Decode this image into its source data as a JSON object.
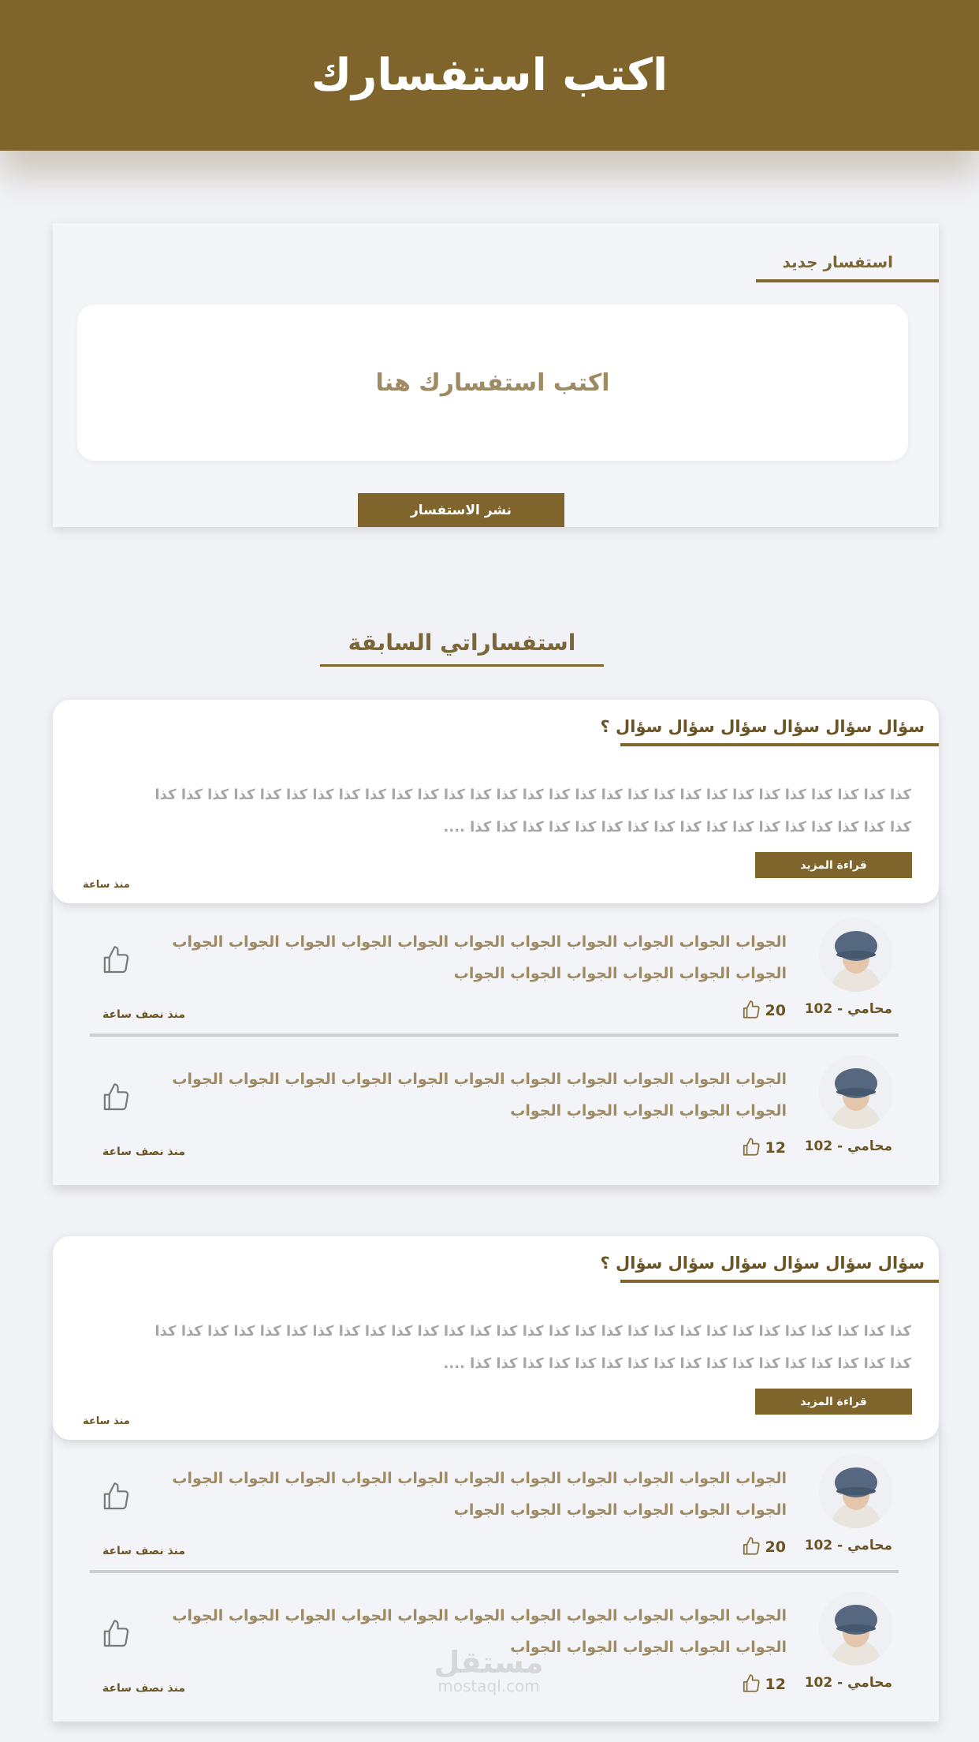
{
  "header": {
    "title": "اكتب استفسارك"
  },
  "new_inquiry": {
    "label": "استفسار جديد",
    "placeholder": "اكتب استفسارك هنا",
    "submit_label": "نشر الاستفسار"
  },
  "previous": {
    "title": "استفساراتي السابقة"
  },
  "colors": {
    "brand": "#7f652b",
    "background": "#f1f2f6"
  },
  "inquiries": [
    {
      "title": "سؤال سؤال سؤال سؤال سؤال سؤال ؟",
      "text": "كذا كذا كذا كذا كذا كذا كذا كذا كذا كذا كذا كذا كذا كذا كذا كذا كذا كذا كذا كذا كذا كذا كذا كذا كذا كذا كذا كذا كذا كذا كذا كذا كذا كذا كذا كذا كذا كذا كذا كذا كذا كذا كذا كذا كذا كذا ....",
      "more_label": "قراءة المزيد",
      "time": "منذ ساعة",
      "answers": [
        {
          "text": "الجواب الجواب الجواب الجواب الجواب الجواب الجواب الجواب الجواب الجواب الجواب الجواب الجواب الجواب الجواب الجواب الجواب",
          "author": "محامي - 102",
          "likes": "20",
          "time": "منذ نصف ساعة",
          "icon": "thumbs-up-icon"
        },
        {
          "text": "الجواب الجواب الجواب الجواب الجواب الجواب الجواب الجواب الجواب الجواب الجواب الجواب الجواب الجواب الجواب الجواب",
          "author": "محامي - 102",
          "likes": "12",
          "time": "منذ نصف ساعة",
          "icon": "thumbs-up-icon"
        }
      ]
    },
    {
      "title": "سؤال سؤال سؤال سؤال سؤال سؤال ؟",
      "text": "كذا كذا كذا كذا كذا كذا كذا كذا كذا كذا كذا كذا كذا كذا كذا كذا كذا كذا كذا كذا كذا كذا كذا كذا كذا كذا كذا كذا كذا كذا كذا كذا كذا كذا كذا كذا كذا كذا كذا كذا كذا كذا كذا كذا كذا كذا ....",
      "more_label": "قراءة المزيد",
      "time": "منذ ساعة",
      "answers": [
        {
          "text": "الجواب الجواب الجواب الجواب الجواب الجواب الجواب الجواب الجواب الجواب الجواب الجواب الجواب الجواب الجواب الجواب الجواب",
          "author": "محامي - 102",
          "likes": "20",
          "time": "منذ نصف ساعة",
          "icon": "thumbs-up-icon"
        },
        {
          "text": "الجواب الجواب الجواب الجواب الجواب الجواب الجواب الجواب الجواب الجواب الجواب الجواب الجواب الجواب الجواب الجواب",
          "author": "محامي - 102",
          "likes": "12",
          "time": "منذ نصف ساعة",
          "icon": "thumbs-up-icon"
        }
      ]
    }
  ],
  "watermark": {
    "arabic": "مستقل",
    "latin": "mostaql.com"
  }
}
